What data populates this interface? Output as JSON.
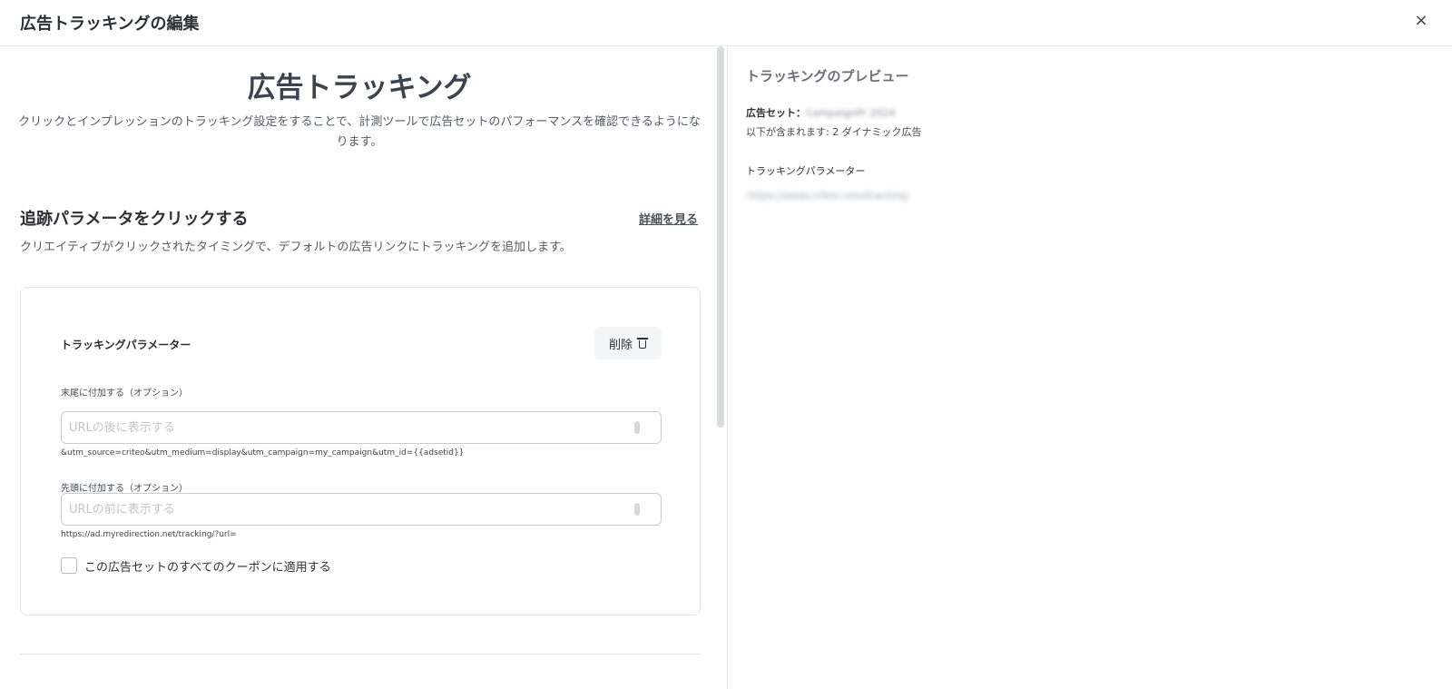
{
  "header": {
    "title": "広告トラッキングの編集",
    "close_label": "×"
  },
  "main": {
    "title": "広告トラッキング",
    "description": "クリックとインプレッションのトラッキング設定をすることで、計測ツールで広告セットのパフォーマンスを確認できるようになります。"
  },
  "click_section": {
    "title": "追跡パラメータをクリックする",
    "details_link": "詳細を見る",
    "description": "クリエイティブがクリックされたタイミングで、デフォルトの広告リンクにトラッキングを追加します。"
  },
  "card": {
    "label": "トラッキングパラメーター",
    "delete_label": "削除",
    "suffix": {
      "label": "末尾に付加する（オプション）",
      "placeholder": "URLの後に表示する",
      "value": "",
      "hint": "&utm_source=criteo&utm_medium=display&utm_campaign=my_campaign&utm_id={{adsetid}}"
    },
    "prefix": {
      "label": "先頭に付加する（オプション）",
      "placeholder": "URLの前に表示する",
      "value": "",
      "hint": "https://ad.myredirection.net/tracking/?url="
    },
    "apply_all": {
      "label": "この広告セットのすべてのクーポンに適用する",
      "checked": false
    }
  },
  "preview": {
    "title": "トラッキングのプレビュー",
    "adset_key": "広告セット：",
    "adset_value": "CampaignPr 2024",
    "includes": "以下が含まれます: 2 ダイナミック広告",
    "param_title": "トラッキングパラメーター",
    "param_value": "https://www.criteo.com/tracking"
  }
}
